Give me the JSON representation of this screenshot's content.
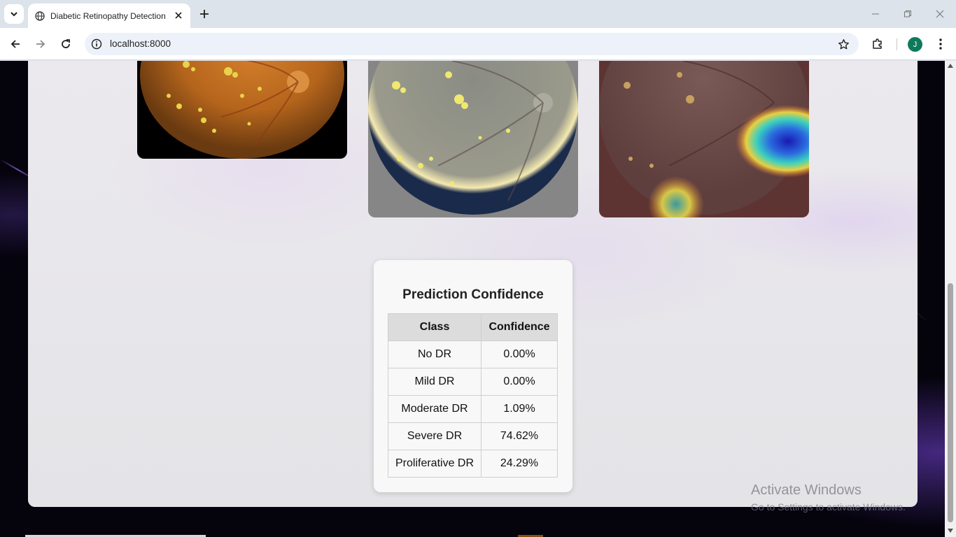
{
  "browser": {
    "tab_title": "Diabetic Retinopathy Detection",
    "url": "localhost:8000",
    "profile_initial": "J"
  },
  "prediction": {
    "title": "Prediction Confidence",
    "headers": {
      "class": "Class",
      "confidence": "Confidence"
    },
    "rows": [
      {
        "class": "No DR",
        "confidence": "0.00%"
      },
      {
        "class": "Mild DR",
        "confidence": "0.00%"
      },
      {
        "class": "Moderate DR",
        "confidence": "1.09%"
      },
      {
        "class": "Severe DR",
        "confidence": "74.62%"
      },
      {
        "class": "Proliferative DR",
        "confidence": "24.29%"
      }
    ]
  },
  "watermark": {
    "line1": "Activate Windows",
    "line2": "Go to Settings to activate Windows."
  },
  "icons": {
    "tab_search": "chevron-down-icon",
    "tab_favicon": "globe-icon",
    "tab_close": "close-icon",
    "new_tab": "plus-icon",
    "back": "arrow-left-icon",
    "forward": "arrow-right-icon",
    "reload": "reload-icon",
    "site_info": "info-icon",
    "bookmark": "star-icon",
    "extensions": "puzzle-icon",
    "menu": "kebab-menu-icon"
  },
  "colors": {
    "avatar": "#0e7a5c",
    "table_header_bg": "#dcdcdc",
    "card_bg": "#f8f8f8"
  }
}
